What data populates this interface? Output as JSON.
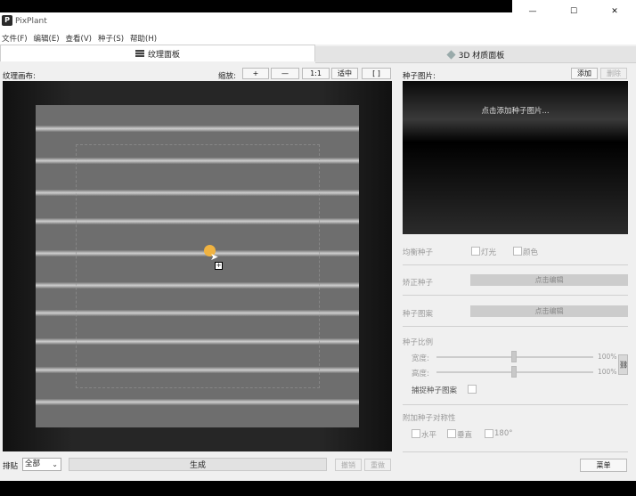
{
  "app": {
    "title": "PixPlant",
    "icon": "pixplant-logo-icon",
    "icon_letter": "P"
  },
  "window_controls": {
    "minimize": "—",
    "maximize": "☐",
    "close": "✕"
  },
  "menu": [
    "文件(F)",
    "编辑(E)",
    "查看(V)",
    "种子(S)",
    "帮助(H)"
  ],
  "tabs": [
    {
      "label": "纹理面板",
      "icon": "texture-icon",
      "active": true
    },
    {
      "label": "3D 材质面板",
      "icon": "cube-icon",
      "active": false
    }
  ],
  "texture_panel": {
    "canvas_label": "纹理画布:",
    "zoom_label": "缩放:",
    "zoom_buttons": {
      "zoom_in": "+",
      "zoom_out": "—",
      "actual": "1:1",
      "fit": "适中",
      "fullscreen": "[ ]"
    },
    "tiling_label": "排贴",
    "tiling_value": "全部",
    "generate": "生成",
    "undo": "撤销",
    "redo": "重做"
  },
  "seed_panel": {
    "title": "种子图片:",
    "add": "添加",
    "delete": "删除",
    "preview_hint": "点击添加种子图片...",
    "balance_label": "均衡种子",
    "balance_light": "灯光",
    "balance_color": "颜色",
    "correct_label": "矫正种子",
    "correct_edit": "点击编辑",
    "pattern_label": "种子图案",
    "pattern_edit": "点击编辑",
    "scale_title": "种子比例",
    "width_label": "宽度:",
    "width_value": "100%",
    "height_label": "高度:",
    "height_value": "100%",
    "capture_label": "捕捉种子图案",
    "symmetry_title": "附加种子对称性",
    "horizontal": "水平",
    "vertical": "垂直",
    "rotate": "180°",
    "menu_button": "菜单"
  },
  "colors": {
    "seed_marker": "#f0b341",
    "texture_base": "#6e6e6e"
  }
}
